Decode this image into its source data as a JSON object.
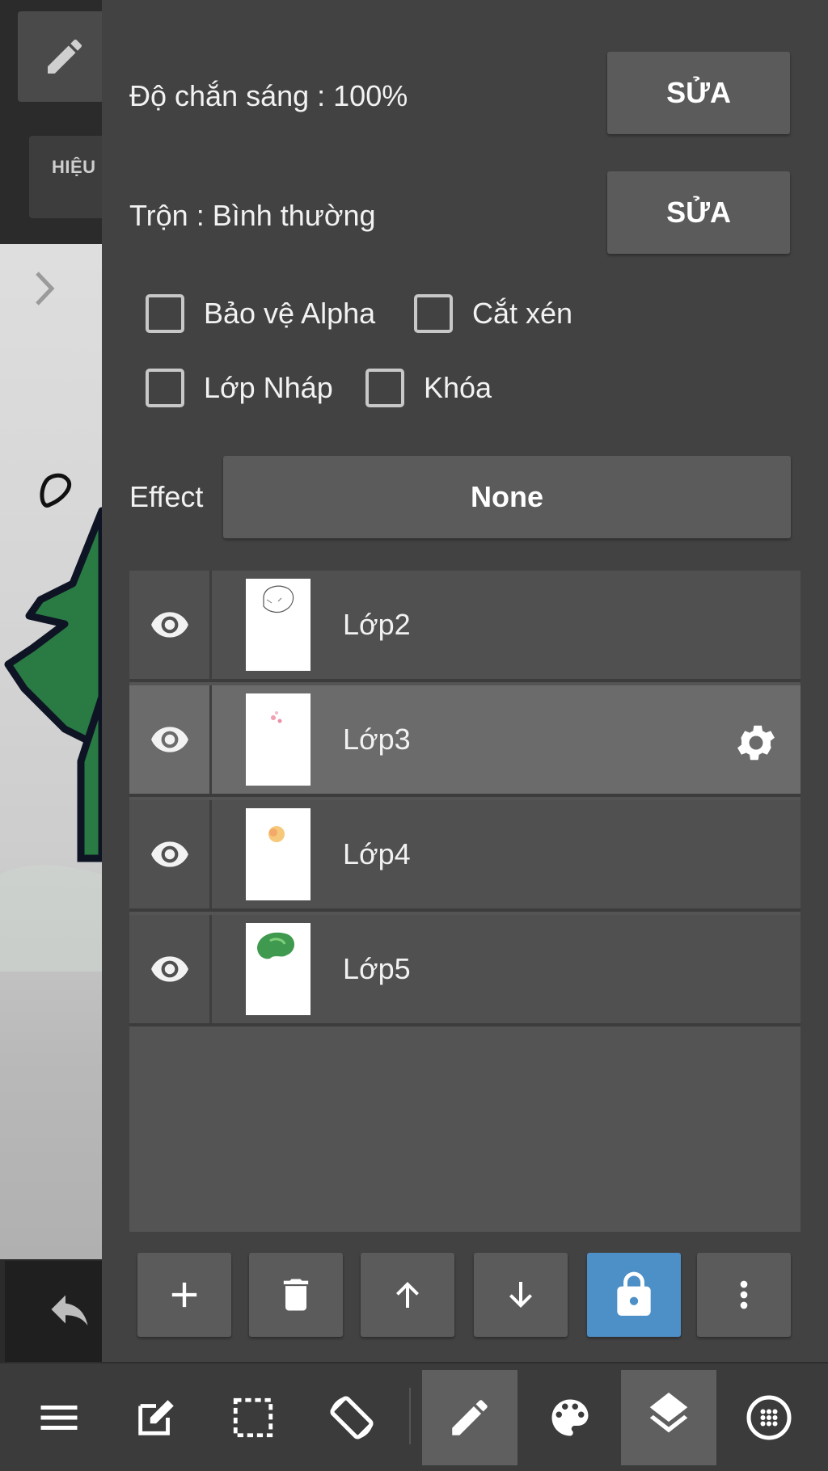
{
  "left": {
    "hieu_label": "HIỆU"
  },
  "settings": {
    "opacity_label": "Độ chắn sáng : 100%",
    "blend_label": "Trộn : Bình thường",
    "edit_label": "SỬA",
    "checkboxes": [
      {
        "label": "Bảo vệ Alpha",
        "checked": false
      },
      {
        "label": "Cắt xén",
        "checked": false
      },
      {
        "label": "Lớp Nháp",
        "checked": false
      },
      {
        "label": "Khóa",
        "checked": false
      }
    ],
    "effect_label": "Effect",
    "effect_value": "None"
  },
  "layers": [
    {
      "name": "Lớp2",
      "visible": true,
      "selected": false
    },
    {
      "name": "Lớp3",
      "visible": true,
      "selected": true
    },
    {
      "name": "Lớp4",
      "visible": true,
      "selected": false
    },
    {
      "name": "Lớp5",
      "visible": true,
      "selected": false
    }
  ],
  "layer_tools": [
    {
      "icon": "plus-icon"
    },
    {
      "icon": "trash-icon"
    },
    {
      "icon": "arrow-up-icon"
    },
    {
      "icon": "arrow-down-icon"
    },
    {
      "icon": "lock-icon",
      "active": true
    },
    {
      "icon": "more-vert-icon"
    }
  ],
  "bottom_bar": [
    {
      "icon": "menu-icon"
    },
    {
      "icon": "edit-icon"
    },
    {
      "icon": "selection-icon"
    },
    {
      "icon": "rotate-icon"
    },
    {
      "icon": "pen-icon",
      "active": true
    },
    {
      "icon": "palette-icon"
    },
    {
      "icon": "layers-icon",
      "active": true
    },
    {
      "icon": "brush-dots-icon"
    }
  ],
  "colors": {
    "panel_bg": "#424242",
    "button_bg": "#5b5b5b",
    "accent_blue": "#4d8fc7",
    "selected_row": "#6b6b6b"
  }
}
